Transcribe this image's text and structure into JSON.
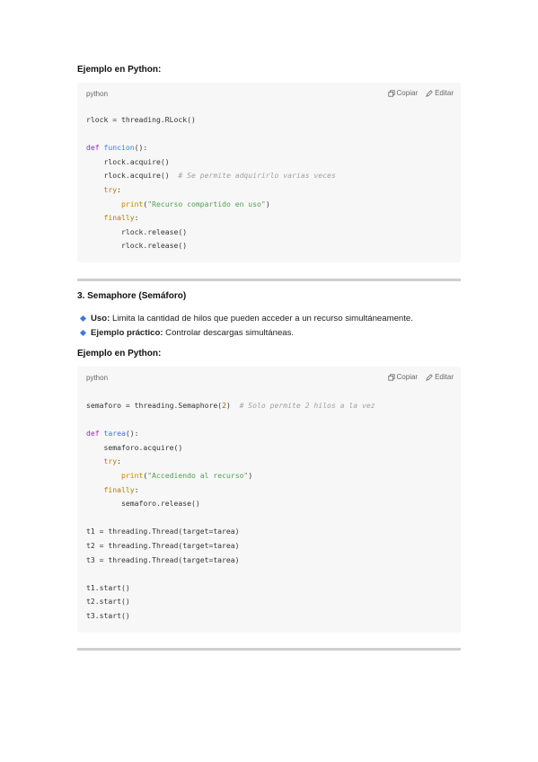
{
  "section1": {
    "heading": "Ejemplo en Python:",
    "code_lang": "python",
    "copy_label": "Copiar",
    "edit_label": "Editar",
    "lines": [
      [
        {
          "t": "rlock = threading.RLock()",
          "c": ""
        }
      ],
      [
        {
          "t": "",
          "c": ""
        }
      ],
      [
        {
          "t": "def ",
          "c": "kw"
        },
        {
          "t": "funcion",
          "c": "fn"
        },
        {
          "t": "():",
          "c": ""
        }
      ],
      [
        {
          "t": "    rlock.acquire()",
          "c": ""
        }
      ],
      [
        {
          "t": "    rlock.acquire()  ",
          "c": ""
        },
        {
          "t": "# Se permite adquirirlo varias veces",
          "c": "cm"
        }
      ],
      [
        {
          "t": "    ",
          "c": ""
        },
        {
          "t": "try",
          "c": "kw2"
        },
        {
          "t": ":",
          "c": ""
        }
      ],
      [
        {
          "t": "        ",
          "c": ""
        },
        {
          "t": "print",
          "c": "bi"
        },
        {
          "t": "(",
          "c": ""
        },
        {
          "t": "\"Recurso compartido en uso\"",
          "c": "st"
        },
        {
          "t": ")",
          "c": ""
        }
      ],
      [
        {
          "t": "    ",
          "c": ""
        },
        {
          "t": "finally",
          "c": "kw2"
        },
        {
          "t": ":",
          "c": ""
        }
      ],
      [
        {
          "t": "        rlock.release()",
          "c": ""
        }
      ],
      [
        {
          "t": "        rlock.release()",
          "c": ""
        }
      ]
    ]
  },
  "section2": {
    "title": "3. Semaphore (Semáforo)",
    "bullets": [
      {
        "label": "Uso:",
        "text": " Limita la cantidad de hilos que pueden acceder a un recurso simultáneamente."
      },
      {
        "label": "Ejemplo práctico:",
        "text": " Controlar descargas simultáneas."
      }
    ],
    "heading": "Ejemplo en Python:",
    "code_lang": "python",
    "copy_label": "Copiar",
    "edit_label": "Editar",
    "lines": [
      [
        {
          "t": "semaforo = threading.Semaphore(",
          "c": ""
        },
        {
          "t": "2",
          "c": "num"
        },
        {
          "t": ")  ",
          "c": ""
        },
        {
          "t": "# Solo permite 2 hilos a la vez",
          "c": "cm"
        }
      ],
      [
        {
          "t": "",
          "c": ""
        }
      ],
      [
        {
          "t": "def ",
          "c": "kw"
        },
        {
          "t": "tarea",
          "c": "fn"
        },
        {
          "t": "():",
          "c": ""
        }
      ],
      [
        {
          "t": "    semaforo.acquire()",
          "c": ""
        }
      ],
      [
        {
          "t": "    ",
          "c": ""
        },
        {
          "t": "try",
          "c": "kw2"
        },
        {
          "t": ":",
          "c": ""
        }
      ],
      [
        {
          "t": "        ",
          "c": ""
        },
        {
          "t": "print",
          "c": "bi"
        },
        {
          "t": "(",
          "c": ""
        },
        {
          "t": "\"Accediendo al recurso\"",
          "c": "st"
        },
        {
          "t": ")",
          "c": ""
        }
      ],
      [
        {
          "t": "    ",
          "c": ""
        },
        {
          "t": "finally",
          "c": "kw2"
        },
        {
          "t": ":",
          "c": ""
        }
      ],
      [
        {
          "t": "        semaforo.release()",
          "c": ""
        }
      ],
      [
        {
          "t": "",
          "c": ""
        }
      ],
      [
        {
          "t": "t1 = threading.Thread(target=tarea)",
          "c": ""
        }
      ],
      [
        {
          "t": "t2 = threading.Thread(target=tarea)",
          "c": ""
        }
      ],
      [
        {
          "t": "t3 = threading.Thread(target=tarea)",
          "c": ""
        }
      ],
      [
        {
          "t": "",
          "c": ""
        }
      ],
      [
        {
          "t": "t1.start()",
          "c": ""
        }
      ],
      [
        {
          "t": "t2.start()",
          "c": ""
        }
      ],
      [
        {
          "t": "t3.start()",
          "c": ""
        }
      ]
    ]
  }
}
